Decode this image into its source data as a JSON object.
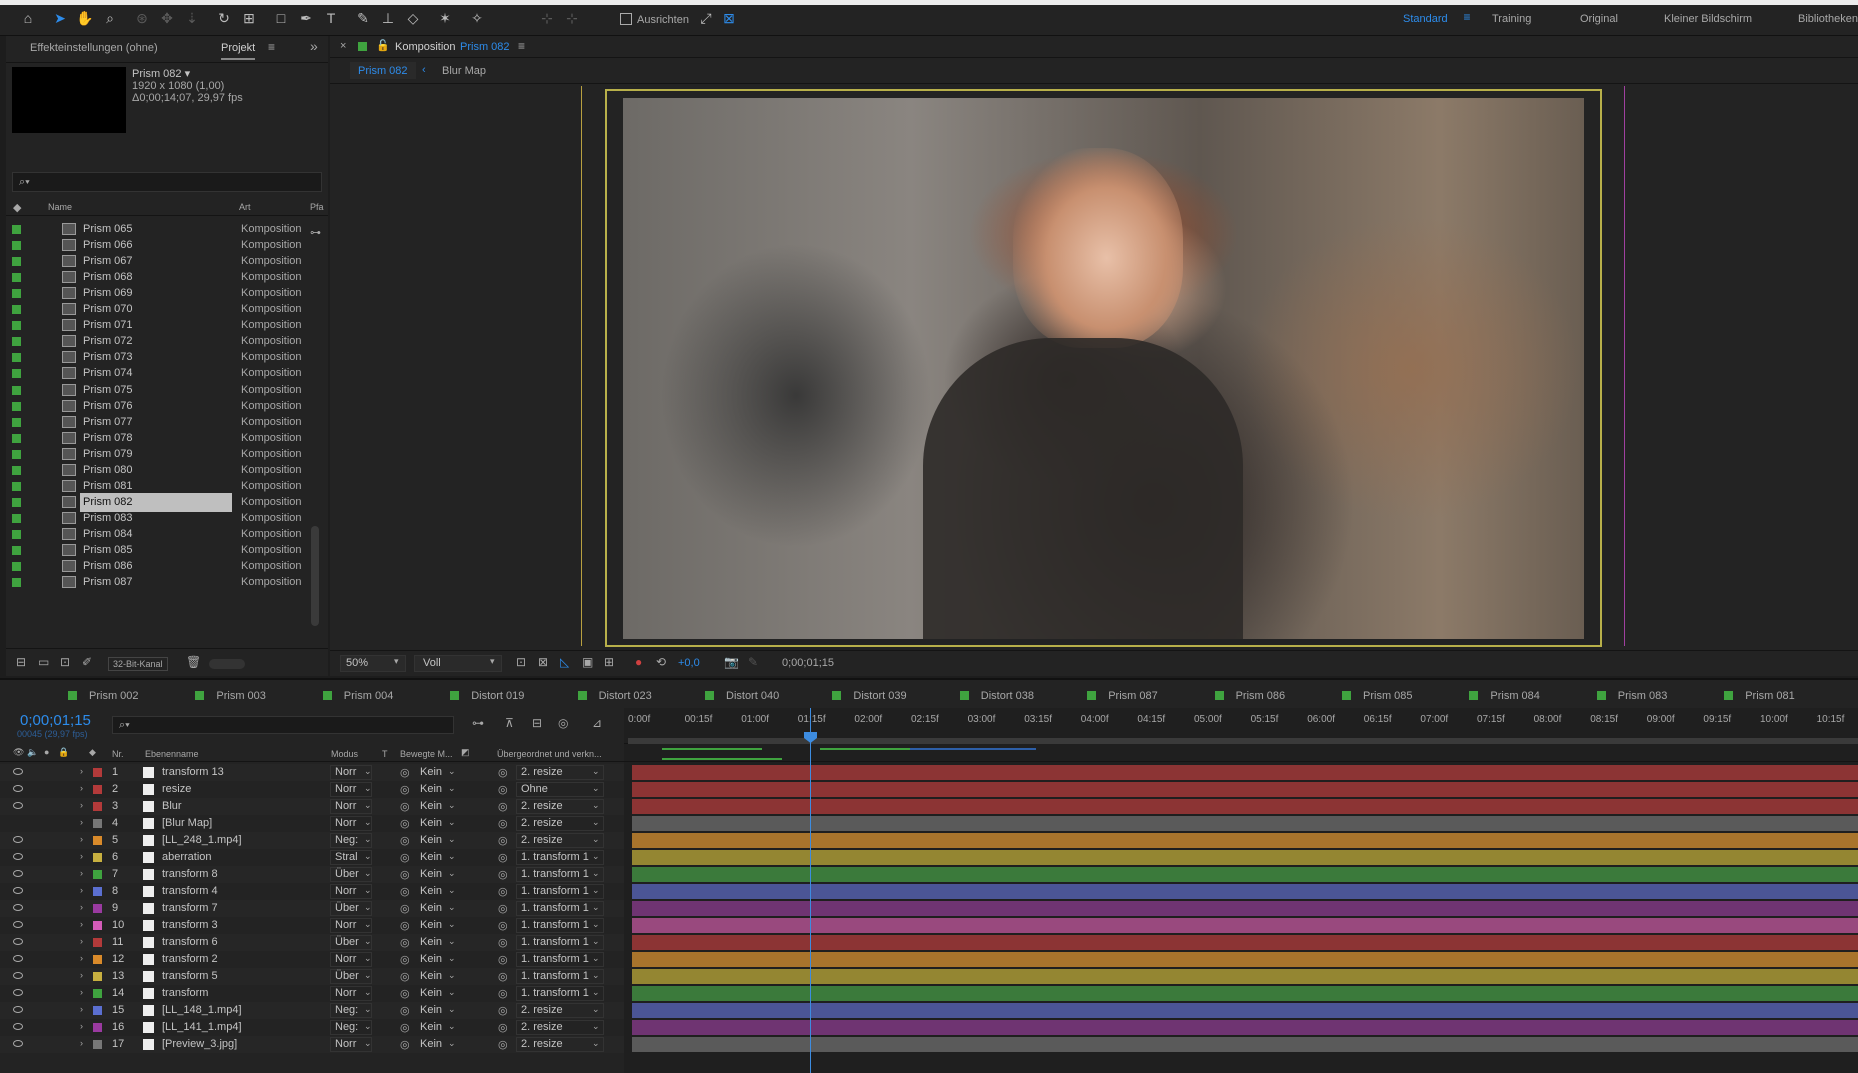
{
  "toolbar": {
    "align_label": "Ausrichten"
  },
  "workspaces": [
    "Standard",
    "Training",
    "Original",
    "Kleiner Bildschirm",
    "Bibliotheken"
  ],
  "left_tabs": {
    "effects": "Effekteinstellungen (ohne)",
    "project": "Projekt"
  },
  "comp_info": {
    "name": "Prism 082 ▾",
    "res": "1920 x 1080 (1,00)",
    "dur": "Δ0;00;14;07, 29,97 fps"
  },
  "project_headers": {
    "name": "Name",
    "type": "Art",
    "extra": "Pfa"
  },
  "project_items": [
    {
      "name": "Prism 065",
      "type": "Komposition"
    },
    {
      "name": "Prism 066",
      "type": "Komposition"
    },
    {
      "name": "Prism 067",
      "type": "Komposition"
    },
    {
      "name": "Prism 068",
      "type": "Komposition"
    },
    {
      "name": "Prism 069",
      "type": "Komposition"
    },
    {
      "name": "Prism 070",
      "type": "Komposition"
    },
    {
      "name": "Prism 071",
      "type": "Komposition"
    },
    {
      "name": "Prism 072",
      "type": "Komposition"
    },
    {
      "name": "Prism 073",
      "type": "Komposition"
    },
    {
      "name": "Prism 074",
      "type": "Komposition"
    },
    {
      "name": "Prism 075",
      "type": "Komposition"
    },
    {
      "name": "Prism 076",
      "type": "Komposition"
    },
    {
      "name": "Prism 077",
      "type": "Komposition"
    },
    {
      "name": "Prism 078",
      "type": "Komposition"
    },
    {
      "name": "Prism 079",
      "type": "Komposition"
    },
    {
      "name": "Prism 080",
      "type": "Komposition"
    },
    {
      "name": "Prism 081",
      "type": "Komposition"
    },
    {
      "name": "Prism 082",
      "type": "Komposition",
      "selected": true
    },
    {
      "name": "Prism 083",
      "type": "Komposition"
    },
    {
      "name": "Prism 084",
      "type": "Komposition"
    },
    {
      "name": "Prism 085",
      "type": "Komposition"
    },
    {
      "name": "Prism 086",
      "type": "Komposition"
    },
    {
      "name": "Prism 087",
      "type": "Komposition"
    }
  ],
  "bit_depth": "32-Bit-Kanal",
  "comp_panel": {
    "label": "Komposition",
    "comp": "Prism 082",
    "crumb1": "Prism 082",
    "crumb2": "Blur Map"
  },
  "viewer": {
    "zoom": "50%",
    "quality": "Voll",
    "exposure": "+0,0",
    "timecode": "0;00;01;15"
  },
  "comp_tabs": [
    {
      "name": "Prism 002",
      "color": "#3fa33f"
    },
    {
      "name": "Prism 003",
      "color": "#3fa33f"
    },
    {
      "name": "Prism 004",
      "color": "#3fa33f"
    },
    {
      "name": "Distort 019",
      "color": "#3fa33f"
    },
    {
      "name": "Distort 023",
      "color": "#3fa33f"
    },
    {
      "name": "Distort 040",
      "color": "#3fa33f"
    },
    {
      "name": "Distort 039",
      "color": "#3fa33f"
    },
    {
      "name": "Distort 038",
      "color": "#3fa33f"
    },
    {
      "name": "Prism 087",
      "color": "#3fa33f"
    },
    {
      "name": "Prism 086",
      "color": "#3fa33f"
    },
    {
      "name": "Prism 085",
      "color": "#3fa33f"
    },
    {
      "name": "Prism 084",
      "color": "#3fa33f"
    },
    {
      "name": "Prism 083",
      "color": "#3fa33f"
    },
    {
      "name": "Prism 081",
      "color": "#3fa33f"
    }
  ],
  "timeline": {
    "timecode": "0;00;01;15",
    "frames": "00045 (29,97 fps)"
  },
  "layer_headers": {
    "nr": "Nr.",
    "name": "Ebenenname",
    "mode": "Modus",
    "t": "T",
    "track": "Bewegte M...",
    "parent": "Übergeordnet und verkn..."
  },
  "ruler": [
    "0:00f",
    "00:15f",
    "01:00f",
    "01:15f",
    "02:00f",
    "02:15f",
    "03:00f",
    "03:15f",
    "04:00f",
    "04:15f",
    "05:00f",
    "05:15f",
    "06:00f",
    "06:15f",
    "07:00f",
    "07:15f",
    "08:00f",
    "08:15f",
    "09:00f",
    "09:15f",
    "10:00f",
    "10:15f"
  ],
  "layers": [
    {
      "nr": "1",
      "name": "transform 13",
      "mode": "Norr",
      "track": "Kein",
      "parent": "2. resize",
      "color": "#b33a3a",
      "bar": "#8c3434",
      "eye": true
    },
    {
      "nr": "2",
      "name": "resize",
      "mode": "Norr",
      "track": "Kein",
      "parent": "Ohne",
      "color": "#b33a3a",
      "bar": "#8c3434",
      "eye": true
    },
    {
      "nr": "3",
      "name": "Blur",
      "mode": "Norr",
      "track": "Kein",
      "parent": "2. resize",
      "color": "#b33a3a",
      "bar": "#8c3434",
      "eye": true
    },
    {
      "nr": "4",
      "name": "[Blur Map]",
      "mode": "Norr",
      "track": "Kein",
      "parent": "2. resize",
      "color": "#777777",
      "bar": "#5a5a5a",
      "eye": false
    },
    {
      "nr": "5",
      "name": "[LL_248_1.mp4]",
      "mode": "Neg:",
      "track": "Kein",
      "parent": "2. resize",
      "color": "#d98a2a",
      "bar": "#a8742c",
      "eye": true
    },
    {
      "nr": "6",
      "name": "aberration",
      "mode": "Stral",
      "track": "Kein",
      "parent": "1. transform 1",
      "color": "#c8b040",
      "bar": "#948632",
      "eye": true
    },
    {
      "nr": "7",
      "name": "transform 8",
      "mode": "Über",
      "track": "Kein",
      "parent": "1. transform 1",
      "color": "#3fa33f",
      "bar": "#3b7a3b",
      "eye": true
    },
    {
      "nr": "8",
      "name": "transform 4",
      "mode": "Norr",
      "track": "Kein",
      "parent": "1. transform 1",
      "color": "#5b6fd0",
      "bar": "#4b5596",
      "eye": true
    },
    {
      "nr": "9",
      "name": "transform 7",
      "mode": "Über",
      "track": "Kein",
      "parent": "1. transform 1",
      "color": "#9a3aa0",
      "bar": "#6f3472",
      "eye": true
    },
    {
      "nr": "10",
      "name": "transform 3",
      "mode": "Norr",
      "track": "Kein",
      "parent": "1. transform 1",
      "color": "#d45bb8",
      "bar": "#99497e",
      "eye": true
    },
    {
      "nr": "11",
      "name": "transform 6",
      "mode": "Über",
      "track": "Kein",
      "parent": "1. transform 1",
      "color": "#b33a3a",
      "bar": "#8c3434",
      "eye": true
    },
    {
      "nr": "12",
      "name": "transform 2",
      "mode": "Norr",
      "track": "Kein",
      "parent": "1. transform 1",
      "color": "#d98a2a",
      "bar": "#a8742c",
      "eye": true
    },
    {
      "nr": "13",
      "name": "transform 5",
      "mode": "Über",
      "track": "Kein",
      "parent": "1. transform 1",
      "color": "#c8b040",
      "bar": "#948632",
      "eye": true
    },
    {
      "nr": "14",
      "name": "transform",
      "mode": "Norr",
      "track": "Kein",
      "parent": "1. transform 1",
      "color": "#3fa33f",
      "bar": "#3b7a3b",
      "eye": true
    },
    {
      "nr": "15",
      "name": "[LL_148_1.mp4]",
      "mode": "Neg:",
      "track": "Kein",
      "parent": "2. resize",
      "color": "#5b6fd0",
      "bar": "#4b5596",
      "eye": true
    },
    {
      "nr": "16",
      "name": "[LL_141_1.mp4]",
      "mode": "Neg:",
      "track": "Kein",
      "parent": "2. resize",
      "color": "#9a3aa0",
      "bar": "#6f3472",
      "eye": true
    },
    {
      "nr": "17",
      "name": "[Preview_3.jpg]",
      "mode": "Norr",
      "track": "Kein",
      "parent": "2. resize",
      "color": "#777777",
      "bar": "#5a5a5a",
      "eye": true
    }
  ]
}
